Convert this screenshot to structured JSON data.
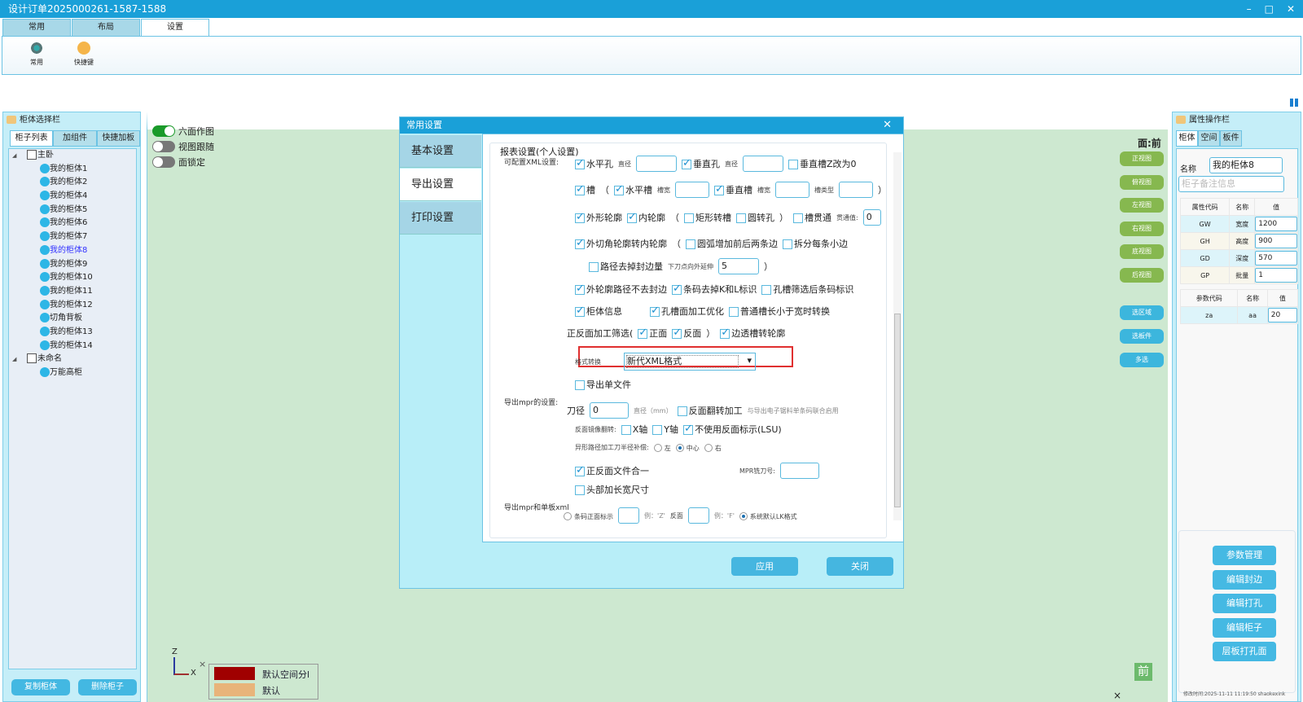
{
  "window": {
    "title": "设计订单2025000261-1587-1588",
    "min": "–",
    "max": "□",
    "close": "✕"
  },
  "ribbon_tabs": [
    {
      "label": "常用"
    },
    {
      "label": "布局"
    },
    {
      "label": "设置",
      "active": true
    }
  ],
  "ribbon_buttons": [
    {
      "label": "常用",
      "icon": "gear-icon"
    },
    {
      "label": "快捷键",
      "icon": "shortcut-icon"
    }
  ],
  "left_panel": {
    "title": "柜体选择栏",
    "tabs": [
      "柜子列表",
      "加组件",
      "快捷加板"
    ],
    "tree": [
      {
        "type": "group",
        "label": "主卧"
      },
      {
        "type": "leaf",
        "label": "我的柜体1"
      },
      {
        "type": "leaf",
        "label": "我的柜体2"
      },
      {
        "type": "leaf",
        "label": "我的柜体4"
      },
      {
        "type": "leaf",
        "label": "我的柜体5"
      },
      {
        "type": "leaf",
        "label": "我的柜体6"
      },
      {
        "type": "leaf",
        "label": "我的柜体7"
      },
      {
        "type": "leaf",
        "label": "我的柜体8",
        "selected": true
      },
      {
        "type": "leaf",
        "label": "我的柜体9"
      },
      {
        "type": "leaf",
        "label": "我的柜体10"
      },
      {
        "type": "leaf",
        "label": "我的柜体11"
      },
      {
        "type": "leaf",
        "label": "我的柜体12"
      },
      {
        "type": "leaf",
        "label": "切角背板"
      },
      {
        "type": "leaf",
        "label": "我的柜体13"
      },
      {
        "type": "leaf",
        "label": "我的柜体14"
      },
      {
        "type": "group",
        "label": "未命名"
      },
      {
        "type": "leaf",
        "label": "万能高柜"
      }
    ],
    "copy_button": "复制柜体",
    "delete_button": "删除柜子"
  },
  "canvas": {
    "toggles": [
      {
        "label": "六面作图",
        "on": true
      },
      {
        "label": "视图跟随",
        "on": false
      },
      {
        "label": "面锁定",
        "on": false
      }
    ],
    "face_label": "面:前",
    "view_buttons": [
      "正视图",
      "俯视图",
      "左视图",
      "右视图",
      "底视图",
      "后视图"
    ],
    "select_buttons": [
      "选区域",
      "选板件",
      "多选"
    ],
    "axis": {
      "z": "Z",
      "x": "X"
    },
    "legend": [
      {
        "label": "默认空间分l",
        "color": "#a00000"
      },
      {
        "label": "默认",
        "color": "#e8b47a"
      }
    ],
    "front_badge": "前",
    "close_x": "×"
  },
  "dialog": {
    "title": "常用设置",
    "close": "✕",
    "nav": [
      {
        "label": "基本设置"
      },
      {
        "label": "导出设置",
        "active": true
      },
      {
        "label": "打印设置"
      }
    ],
    "fieldset": "报表设置(个人设置)",
    "section_labels": {
      "xml": "可配置XML设置:",
      "mpr": "导出mpr的设置:",
      "mprxml": "导出mpr和单板xml"
    },
    "rows": [
      [
        {
          "t": "check",
          "on": true,
          "label": "水平孔"
        },
        {
          "t": "sm",
          "label": "直径"
        },
        {
          "t": "input",
          "value": "",
          "w": 50
        },
        {
          "t": "check",
          "on": true,
          "label": "垂直孔"
        },
        {
          "t": "sm",
          "label": "直径"
        },
        {
          "t": "input",
          "value": "",
          "w": 50
        },
        {
          "t": "check",
          "on": false,
          "label": "垂直槽Z改为0"
        }
      ],
      [
        {
          "t": "check",
          "on": true,
          "label": "槽"
        },
        {
          "t": "text",
          "label": "（"
        },
        {
          "t": "check",
          "on": true,
          "label": "水平槽"
        },
        {
          "t": "sm",
          "label": "槽宽"
        },
        {
          "t": "input",
          "value": "",
          "w": 42
        },
        {
          "t": "check",
          "on": true,
          "label": "垂直槽"
        },
        {
          "t": "sm",
          "label": "槽宽"
        },
        {
          "t": "input",
          "value": "",
          "w": 42
        },
        {
          "t": "sm",
          "label": "槽类型"
        },
        {
          "t": "input",
          "value": "",
          "w": 42
        },
        {
          "t": "text",
          "label": "）"
        }
      ],
      [
        {
          "t": "check",
          "on": true,
          "label": "外形轮廓"
        },
        {
          "t": "check",
          "on": true,
          "label": "内轮廓"
        },
        {
          "t": "text",
          "label": "（"
        },
        {
          "t": "check",
          "on": false,
          "label": "矩形转槽"
        },
        {
          "t": "check",
          "on": false,
          "label": "圆转孔"
        },
        {
          "t": "text",
          "label": "）"
        },
        {
          "t": "check",
          "on": false,
          "label": "槽贯通"
        },
        {
          "t": "sm",
          "label": "贯通值:"
        },
        {
          "t": "input",
          "value": "0",
          "w": 22
        }
      ],
      [
        {
          "t": "check",
          "on": true,
          "label": "外切角轮廓转内轮廓"
        },
        {
          "t": "text",
          "label": "（"
        },
        {
          "t": "check",
          "on": false,
          "label": "圆弧增加前后两条边"
        },
        {
          "t": "check",
          "on": false,
          "label": "拆分每条小边"
        }
      ],
      [
        {
          "t": "check",
          "on": false,
          "label": "路径去掉封边量"
        },
        {
          "t": "sm",
          "label": "下刀点向外延伸"
        },
        {
          "t": "input",
          "value": "5",
          "w": 50
        },
        {
          "t": "text",
          "label": "）"
        }
      ],
      [
        {
          "t": "check",
          "on": true,
          "label": "外轮廓路径不去封边"
        },
        {
          "t": "check",
          "on": true,
          "label": "条码去掉K和L标识"
        },
        {
          "t": "check",
          "on": false,
          "label": "孔槽筛选后条码标识"
        }
      ],
      [
        {
          "t": "check",
          "on": true,
          "label": "柜体信息"
        },
        {
          "t": "text",
          "label": "　　"
        },
        {
          "t": "check",
          "on": true,
          "label": "孔槽面加工优化"
        },
        {
          "t": "check",
          "on": false,
          "label": "普通槽长小于宽时转换"
        }
      ],
      [
        {
          "t": "text",
          "label": "正反面加工筛选("
        },
        {
          "t": "check",
          "on": true,
          "label": "正面"
        },
        {
          "t": "check",
          "on": true,
          "label": "反面"
        },
        {
          "t": "text",
          "label": "）"
        },
        {
          "t": "check",
          "on": true,
          "label": "边透槽转轮廓"
        }
      ],
      [
        {
          "t": "sm",
          "label": "格式转换"
        },
        {
          "t": "select",
          "value": "新代XML格式"
        }
      ],
      [
        {
          "t": "check",
          "on": false,
          "label": "导出单文件"
        }
      ],
      [
        {
          "t": "text",
          "label": "刀径"
        },
        {
          "t": "input",
          "value": "0",
          "w": 48
        },
        {
          "t": "hint",
          "label": "直径（mm）"
        },
        {
          "t": "check",
          "on": false,
          "label": "反面翻转加工"
        },
        {
          "t": "hint",
          "label": "与导出电子锯料单条码联合启用"
        }
      ],
      [
        {
          "t": "sm",
          "label": "反面镜像翻转:"
        },
        {
          "t": "check",
          "on": false,
          "label": "X轴"
        },
        {
          "t": "check",
          "on": false,
          "label": "Y轴"
        },
        {
          "t": "check",
          "on": true,
          "label": "不使用反面标示(LSU)"
        }
      ],
      [
        {
          "t": "sm",
          "label": "异形路径加工刀半径补偿:"
        },
        {
          "t": "radio",
          "on": false,
          "label": "左"
        },
        {
          "t": "radio",
          "on": true,
          "label": "中心"
        },
        {
          "t": "radio",
          "on": false,
          "label": "右"
        }
      ],
      [
        {
          "t": "check",
          "on": true,
          "label": "正反面文件合一"
        },
        {
          "t": "text",
          "label": "　　　　　　　　　"
        },
        {
          "t": "sm",
          "label": "MPR铣刀号:"
        },
        {
          "t": "input",
          "value": "",
          "w": 48
        }
      ],
      [
        {
          "t": "check",
          "on": false,
          "label": "头部加长宽尺寸"
        }
      ],
      [
        {
          "t": "radio",
          "on": false,
          "label": "条码正面标示"
        },
        {
          "t": "input",
          "value": "",
          "w": 26
        },
        {
          "t": "hint",
          "label": "例：'Z'"
        },
        {
          "t": "sm",
          "label": "反面"
        },
        {
          "t": "input",
          "value": "",
          "w": 26
        },
        {
          "t": "hint",
          "label": "例：'F'"
        },
        {
          "t": "radio",
          "on": true,
          "label": "系统默认LK格式"
        }
      ]
    ],
    "apply_button": "应用",
    "close_button": "关闭"
  },
  "right_panel": {
    "title": "属性操作栏",
    "tabs": [
      "柜体",
      "空间",
      "板件"
    ],
    "name_label": "名称",
    "name_value": "我的柜体8",
    "remark_placeholder": "柜子备注信息",
    "attr_headers": [
      "属性代码",
      "名称",
      "值"
    ],
    "attrs": [
      {
        "code": "GW",
        "name": "宽度",
        "value": "1200"
      },
      {
        "code": "GH",
        "name": "高度",
        "value": "900"
      },
      {
        "code": "GD",
        "name": "深度",
        "value": "570"
      },
      {
        "code": "GP",
        "name": "批量",
        "value": "1"
      }
    ],
    "param_headers": [
      "参数代码",
      "名称",
      "值"
    ],
    "params": [
      {
        "code": "za",
        "name": "aa",
        "value": "20"
      }
    ],
    "buttons": [
      "参数管理",
      "编辑封边",
      "编辑打孔",
      "编辑柜子",
      "层板打孔面"
    ],
    "footer": "修改时间:2025-11-11 11:19:50 shaokexink"
  },
  "colors": {
    "accent": "#1aa0d8",
    "canvas": "#cde8d0",
    "view_button": "#86b84f",
    "action_button": "#45b6e0",
    "highlight": "#e03030"
  }
}
